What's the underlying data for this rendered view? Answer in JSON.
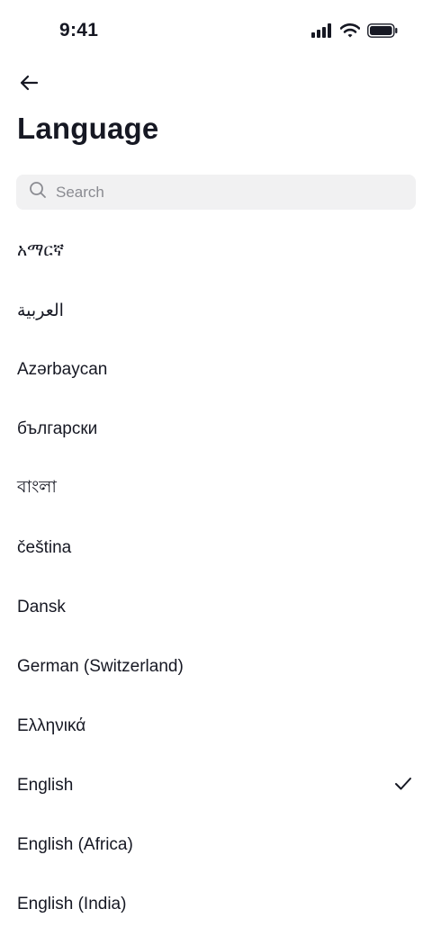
{
  "status_bar": {
    "time": "9:41"
  },
  "header": {
    "back_icon": "arrow-left-icon",
    "title": "Language"
  },
  "search": {
    "placeholder": "Search",
    "value": ""
  },
  "languages": {
    "selected": "English",
    "items": [
      {
        "label": "አማርኛ"
      },
      {
        "label": "العربية"
      },
      {
        "label": "Azərbaycan"
      },
      {
        "label": "български"
      },
      {
        "label": "বাংলা"
      },
      {
        "label": "čeština"
      },
      {
        "label": "Dansk"
      },
      {
        "label": "German (Switzerland)"
      },
      {
        "label": "Ελληνικά"
      },
      {
        "label": "English"
      },
      {
        "label": "English (Africa)"
      },
      {
        "label": "English (India)"
      }
    ]
  },
  "colors": {
    "text": "#161823",
    "search_bg": "#f1f1f2",
    "placeholder": "#8a8b91"
  }
}
